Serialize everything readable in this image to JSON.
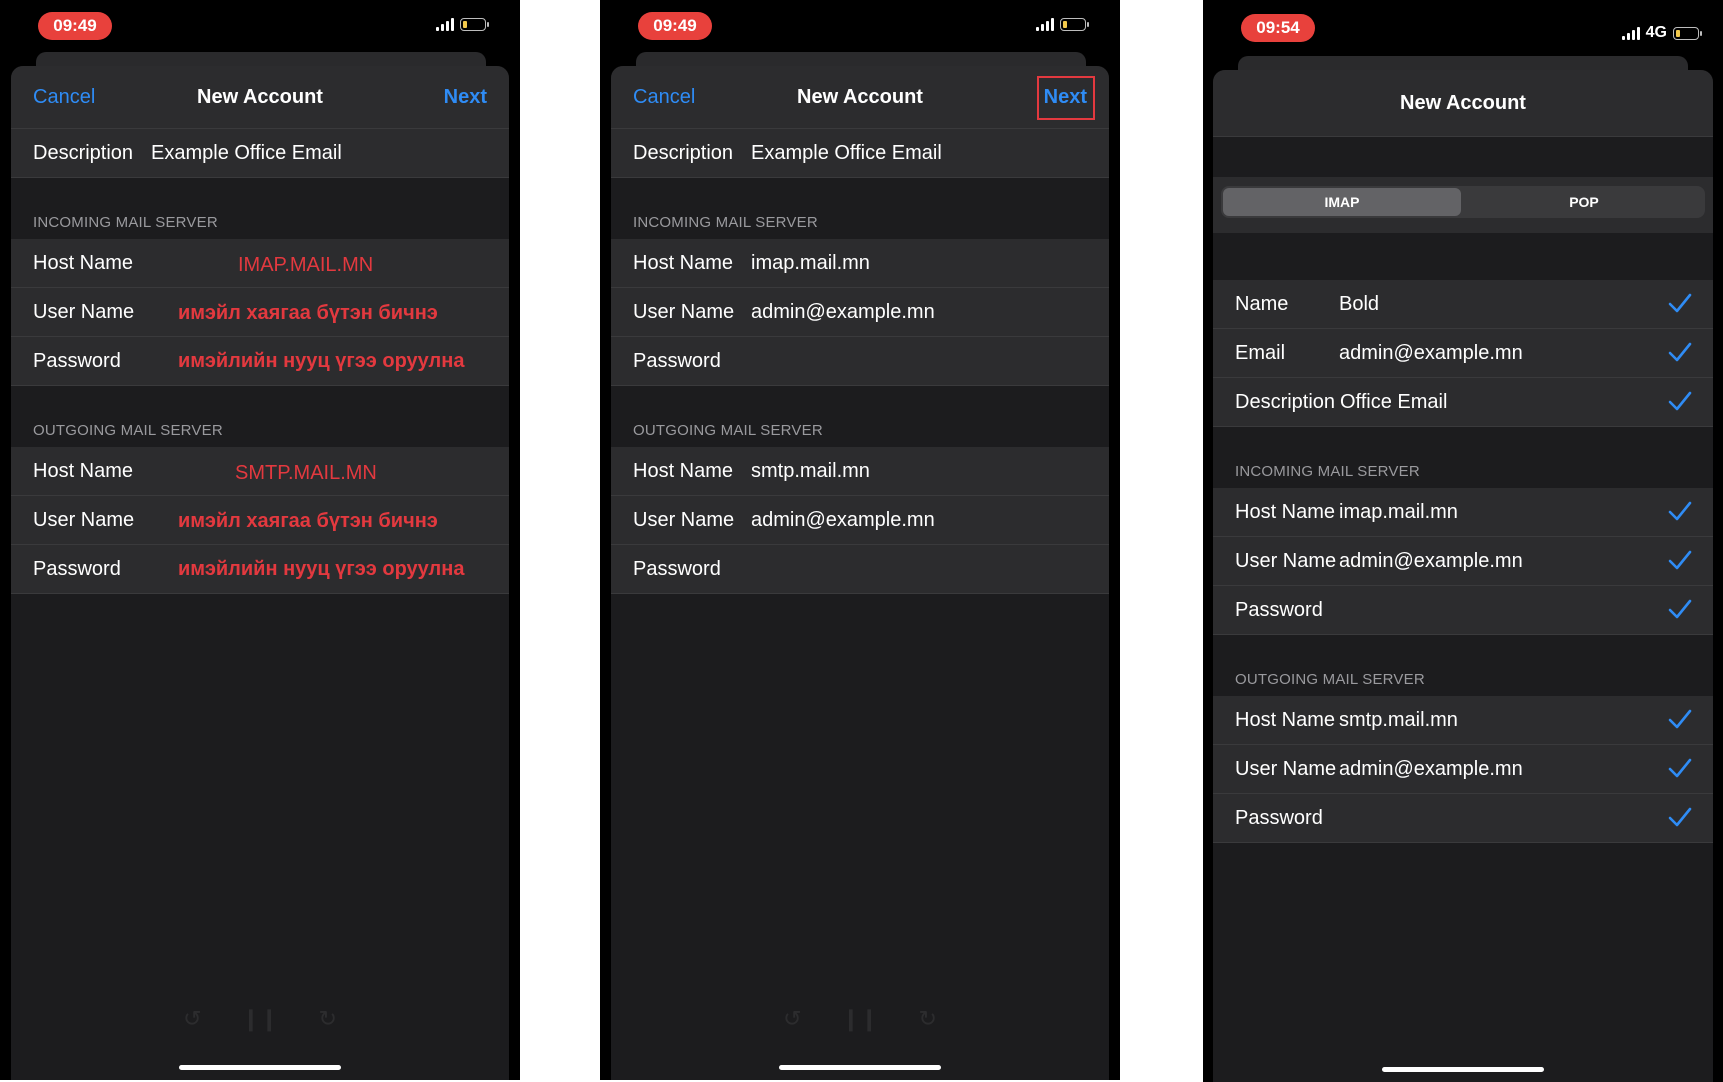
{
  "panels": [
    {
      "time": "09:49",
      "title": "New Account",
      "cancel": "Cancel",
      "next": "Next",
      "description_label": "Description",
      "description_value": "Example Office Email",
      "incoming_header": "INCOMING MAIL SERVER",
      "incoming": [
        {
          "label": "Host Name",
          "value": "IMAP.MAIL.MN"
        },
        {
          "label": "User Name",
          "value": "имэйл хаягаа бүтэн бичнэ"
        },
        {
          "label": "Password",
          "value": "имэйлийн нууц үгээ оруулна"
        }
      ],
      "outgoing_header": "OUTGOING MAIL SERVER",
      "outgoing": [
        {
          "label": "Host Name",
          "value": "SMTP.MAIL.MN"
        },
        {
          "label": "User Name",
          "value": "имэйл хаягаа бүтэн бичнэ"
        },
        {
          "label": "Password",
          "value": "имэйлийн нууц үгээ оруулна"
        }
      ],
      "annotation_color": "#e3393f"
    },
    {
      "time": "09:49",
      "title": "New Account",
      "cancel": "Cancel",
      "next": "Next",
      "description_label": "Description",
      "description_value": "Example Office Email",
      "incoming_header": "INCOMING MAIL SERVER",
      "incoming": [
        {
          "label": "Host Name",
          "value": "imap.mail.mn"
        },
        {
          "label": "User Name",
          "value": "admin@example.mn"
        },
        {
          "label": "Password",
          "value": ""
        }
      ],
      "outgoing_header": "OUTGOING MAIL SERVER",
      "outgoing": [
        {
          "label": "Host Name",
          "value": "smtp.mail.mn"
        },
        {
          "label": "User Name",
          "value": "admin@example.mn"
        },
        {
          "label": "Password",
          "value": ""
        }
      ],
      "highlight_color": "#e3393f"
    },
    {
      "time": "09:54",
      "network": "4G",
      "title": "New Account",
      "segments": [
        "IMAP",
        "POP"
      ],
      "selected_segment": "IMAP",
      "account": [
        {
          "label": "Name",
          "value": "Bold"
        },
        {
          "label": "Email",
          "value": "admin@example.mn"
        },
        {
          "label": "Description",
          "value": "Office Email"
        }
      ],
      "incoming_header": "INCOMING MAIL SERVER",
      "incoming": [
        {
          "label": "Host Name",
          "value": "imap.mail.mn"
        },
        {
          "label": "User Name",
          "value": "admin@example.mn"
        },
        {
          "label": "Password",
          "value": ""
        }
      ],
      "outgoing_header": "OUTGOING MAIL SERVER",
      "outgoing": [
        {
          "label": "Host Name",
          "value": "smtp.mail.mn"
        },
        {
          "label": "User Name",
          "value": "admin@example.mn"
        },
        {
          "label": "Password",
          "value": ""
        }
      ],
      "check_color": "#2f8cf5"
    }
  ],
  "colors": {
    "accent": "#2f8cf5",
    "background": "#1c1c1e",
    "row": "#2c2c2e",
    "time_pill": "#e8413c"
  }
}
